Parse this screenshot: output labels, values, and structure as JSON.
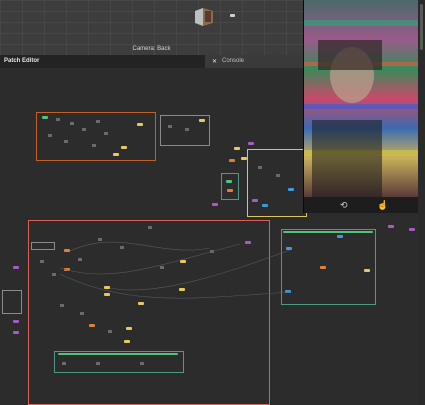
{
  "viewport": {
    "camera_label": "Camera: Back"
  },
  "tabs": {
    "patch_editor": "Patch Editor",
    "console": "Console"
  },
  "icons": {
    "close": "close-icon",
    "flip_camera": "flip-camera-icon",
    "touch": "touch-icon"
  },
  "colors": {
    "group_orange": "#c2602c",
    "group_grey": "#8a8a8a",
    "group_teal": "#4f9a86",
    "group_yellow": "#d8c65a",
    "group_red": "#d9605a",
    "port_yellow": "#e8c85a",
    "port_orange": "#e07f3a",
    "port_blue": "#3b9be0",
    "port_purple": "#a659c8",
    "port_green": "#4fc37a"
  }
}
